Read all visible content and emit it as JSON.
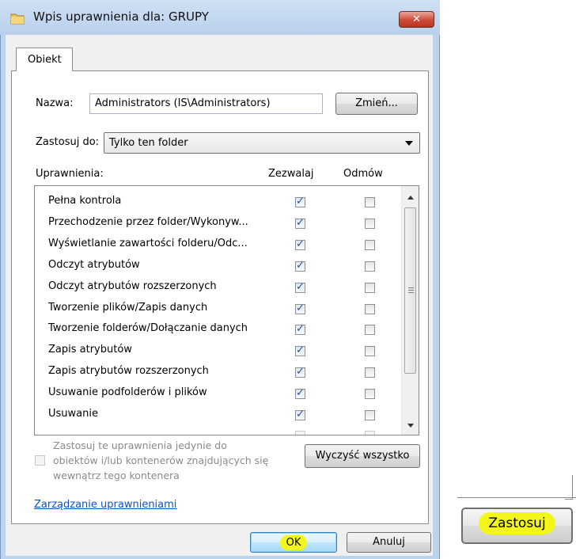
{
  "window": {
    "title": "Wpis uprawnienia dla: GRUPY",
    "close_label": "✕"
  },
  "tabs": [
    {
      "label": "Obiekt"
    }
  ],
  "name_row": {
    "label": "Nazwa:",
    "value": "Administrators (IS\\Administrators)",
    "change_button": "Zmień..."
  },
  "apply_to": {
    "label": "Zastosuj do:",
    "value": "Tylko ten folder"
  },
  "permissions": {
    "header": "Uprawnienia:",
    "allow_header": "Zezwalaj",
    "deny_header": "Odmów",
    "items": [
      {
        "label": "Pełna kontrola",
        "allow": true,
        "deny": false
      },
      {
        "label": "Przechodzenie przez folder/Wykonyw...",
        "allow": true,
        "deny": false
      },
      {
        "label": "Wyświetlanie zawartości folderu/Odc...",
        "allow": true,
        "deny": false
      },
      {
        "label": "Odczyt atrybutów",
        "allow": true,
        "deny": false
      },
      {
        "label": "Odczyt atrybutów rozszerzonych",
        "allow": true,
        "deny": false
      },
      {
        "label": "Tworzenie plików/Zapis danych",
        "allow": true,
        "deny": false
      },
      {
        "label": "Tworzenie folderów/Dołączanie danych",
        "allow": true,
        "deny": false
      },
      {
        "label": "Zapis atrybutów",
        "allow": true,
        "deny": false
      },
      {
        "label": "Zapis atrybutów rozszerzonych",
        "allow": true,
        "deny": false
      },
      {
        "label": "Usuwanie podfolderów i plików",
        "allow": true,
        "deny": false
      },
      {
        "label": "Usuwanie",
        "allow": true,
        "deny": false
      }
    ]
  },
  "inherit_option": {
    "line1": "Zastosuj te uprawnienia jedynie do",
    "line2": "obiektów i/lub kontenerów znajdujących się",
    "line3": "wewnątrz tego kontenera",
    "checked": false
  },
  "clear_all_button": "Wyczyść wszystko",
  "manage_link": "Zarządzanie uprawnieniami",
  "buttons": {
    "ok": "OK",
    "cancel": "Anuluj"
  },
  "apply_button": "Zastosuj",
  "colors": {
    "highlight": "#f3f61b",
    "link": "#0a52c9",
    "accent": "#2b4c8c"
  }
}
